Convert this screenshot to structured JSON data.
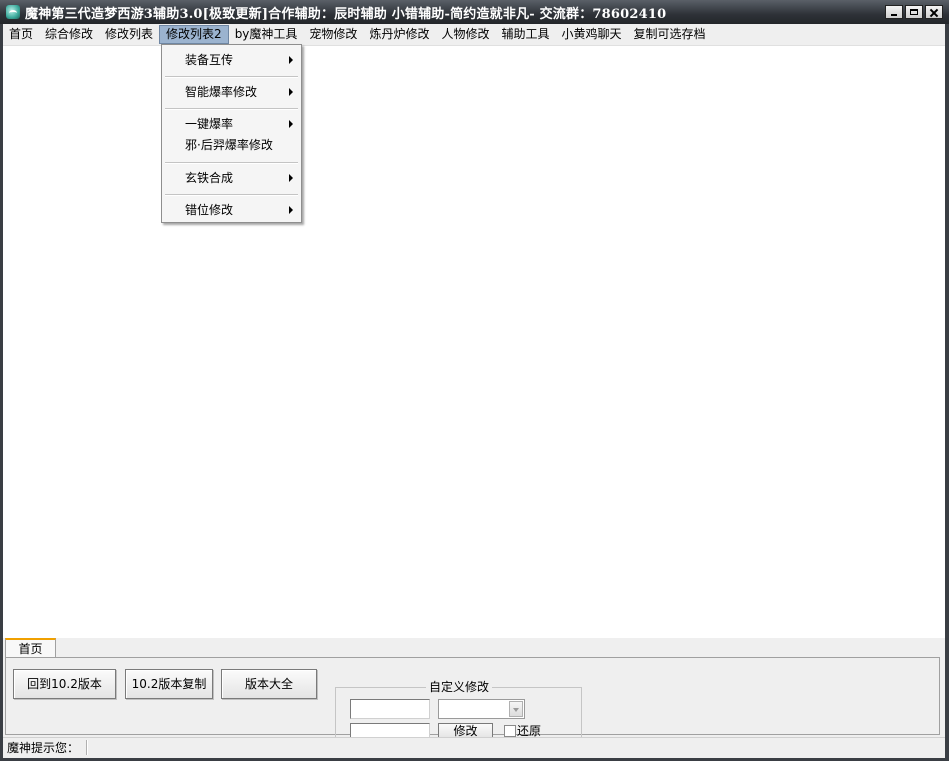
{
  "window": {
    "title": "魔神第三代造梦西游3辅助3.0[极致更新]合作辅助：辰时辅助 小错辅助-简约造就非凡- 交流群：78602410",
    "accent": "#9bb3cf"
  },
  "menubar": {
    "items": [
      {
        "label": "首页"
      },
      {
        "label": "综合修改"
      },
      {
        "label": "修改列表"
      },
      {
        "label": "修改列表2",
        "active": true
      },
      {
        "label": "by魔神工具"
      },
      {
        "label": "宠物修改"
      },
      {
        "label": "炼丹炉修改"
      },
      {
        "label": "人物修改"
      },
      {
        "label": "辅助工具"
      },
      {
        "label": "小黄鸡聊天"
      },
      {
        "label": "复制可选存档"
      }
    ]
  },
  "dropdown": {
    "items": [
      {
        "label": "装备互传",
        "submenu": true
      },
      {
        "label": "智能爆率修改",
        "submenu": true
      },
      {
        "label": "一键爆率",
        "submenu": true
      },
      {
        "label": "邪·后羿爆率修改",
        "submenu": false
      },
      {
        "label": "玄铁合成",
        "submenu": true
      },
      {
        "label": "错位修改",
        "submenu": true
      }
    ]
  },
  "bottom": {
    "tab_label": "首页",
    "buttons": {
      "back_to_10_2": "回到10.2版本",
      "copy_10_2": "10.2版本复制",
      "all_versions": "版本大全"
    },
    "custom_group": {
      "legend": "自定义修改",
      "field1_value": "",
      "field2_value": "",
      "combo_value": "",
      "modify_button": "修改",
      "restore_label": "还原",
      "restore_checked": false
    }
  },
  "statusbar": {
    "label": "魔神提示您："
  }
}
